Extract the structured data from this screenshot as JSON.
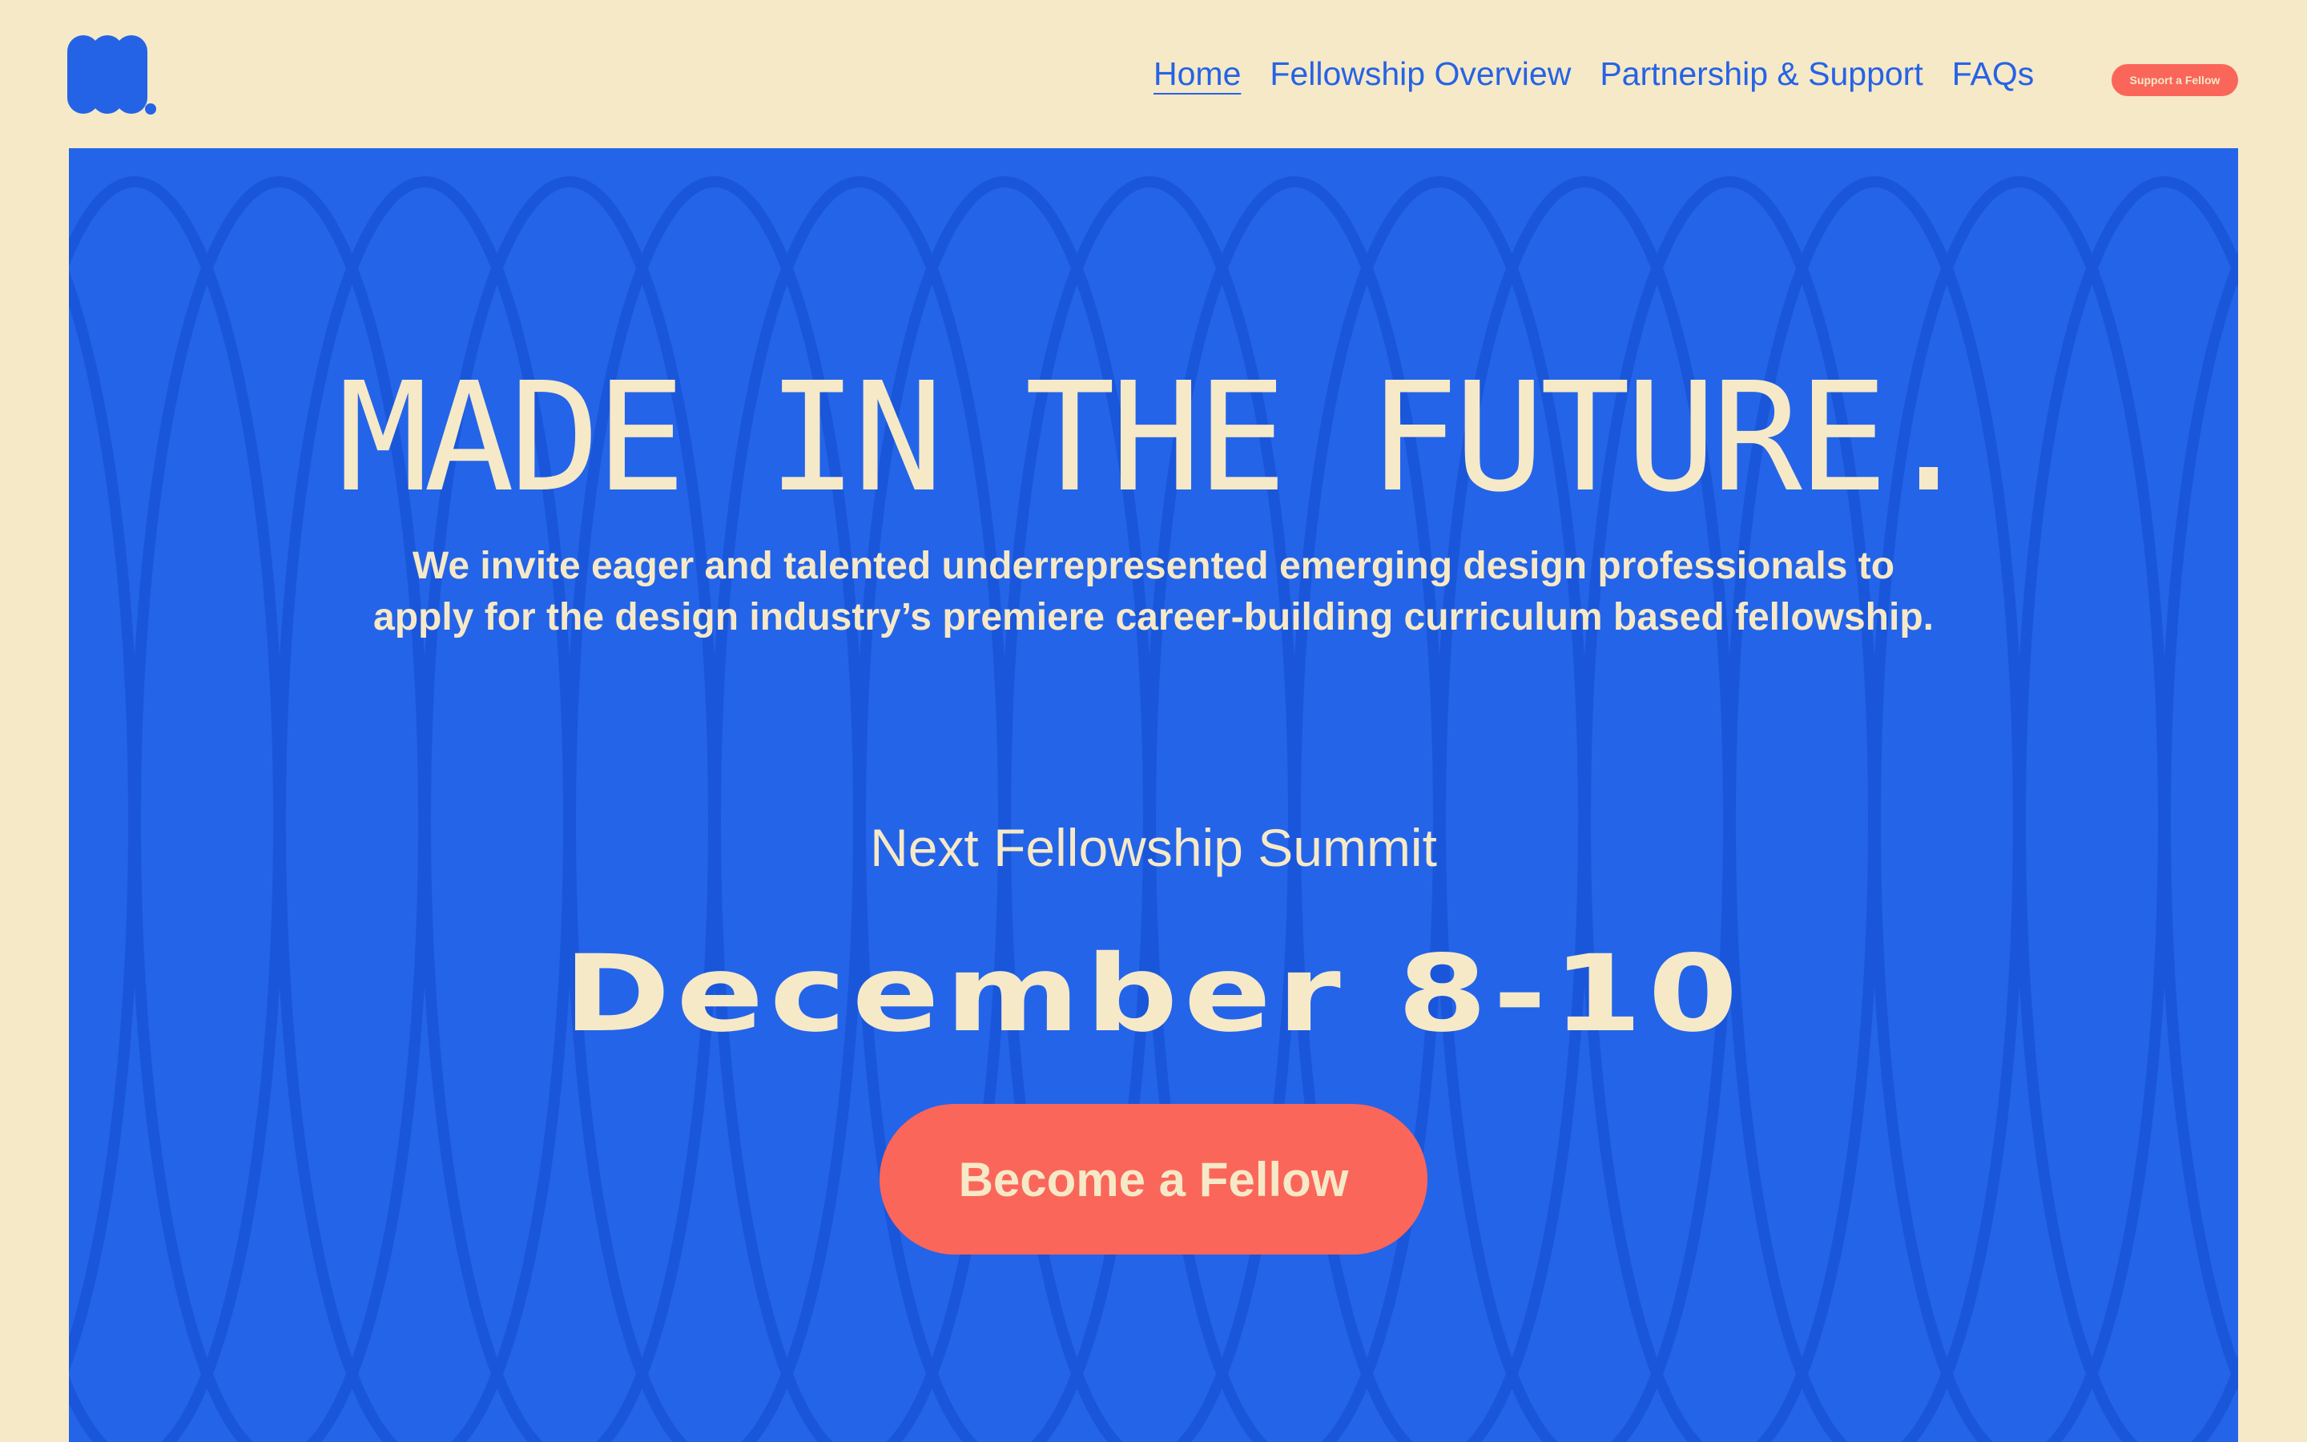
{
  "brand": {
    "logo_icon": "m-logo-icon",
    "colors": {
      "background": "#f6e9c7",
      "primary_blue": "#2464e8",
      "accent_coral": "#fb665a",
      "cream_text": "#f6e9c7"
    }
  },
  "nav": {
    "items": [
      {
        "label": "Home",
        "active": true
      },
      {
        "label": "Fellowship Overview",
        "active": false
      },
      {
        "label": "Partnership & Support",
        "active": false
      },
      {
        "label": "FAQs",
        "active": false
      }
    ],
    "support_button": "Support a Fellow"
  },
  "hero": {
    "title": "MADE IN THE FUTURE.",
    "description": "We invite eager and talented underrepresented emerging design professionals to apply for the design industry’s premiere career-building curriculum based fellowship.",
    "summit_label": "Next Fellowship Summit",
    "summit_date": "December 8-10",
    "cta_label": "Become a Fellow"
  }
}
